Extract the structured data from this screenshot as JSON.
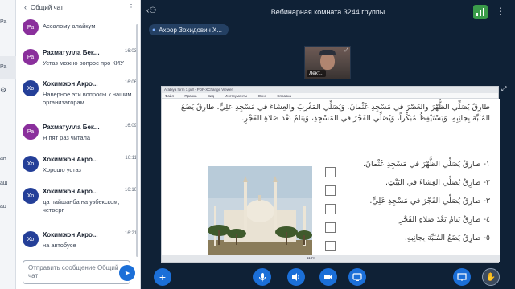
{
  "left_strip": {
    "items": [
      {
        "label": "Ра"
      },
      {
        "label": "ан"
      },
      {
        "label": "аш"
      },
      {
        "label": "ац"
      }
    ]
  },
  "chat": {
    "title": "Общий чат",
    "input_placeholder": "Отправить сообщение Общий чат",
    "messages": [
      {
        "initials": "Ра",
        "name": "",
        "time": "",
        "text": "Ассалому алайкум",
        "avatar_color": "#8a2f9c"
      },
      {
        "initials": "Ра",
        "name": "Рахматулла Бек...",
        "time": "16:03",
        "text": "Устаз можно вопрос про КИУ",
        "avatar_color": "#8a2f9c"
      },
      {
        "initials": "Хо",
        "name": "Хокимжон Акро...",
        "time": "16:06",
        "text": "Наверное эти вопросы к нашим организаторам",
        "avatar_color": "#243f98"
      },
      {
        "initials": "Ра",
        "name": "Рахматулла Бек...",
        "time": "16:09",
        "text": "Я пят раз читала",
        "avatar_color": "#8a2f9c"
      },
      {
        "initials": "Хо",
        "name": "Хокимжон Акро...",
        "time": "16:11",
        "text": "Хорошо устаз",
        "avatar_color": "#243f98"
      },
      {
        "initials": "Хо",
        "name": "Хокимжон Акро...",
        "time": "16:16",
        "text": "да пайшанба на узбекском, четверг",
        "avatar_color": "#243f98"
      },
      {
        "initials": "Хо",
        "name": "Хокимжон Акро...",
        "time": "16:21",
        "text": "на автобусе",
        "avatar_color": "#243f98"
      }
    ]
  },
  "room": {
    "title": "Вебинарная комната 3244 группы",
    "presenter_name": "Ахрор Зохидович Х...",
    "webcam_label": "Лект..."
  },
  "shared_screen": {
    "window_title": "Arabiya form 1.pdf - PDF-XChange Viewer",
    "menu": [
      "Файл",
      "Правка",
      "Вид",
      "Инструменты",
      "Окно",
      "Справка"
    ],
    "paragraph": "طارِقٌ يُصَلِّي الظُّهْرَ والعَصْرَ في مَسْجِدِ عُثْمانَ. وَيُصَلِّي المَغْرِبَ والعِشاءَ في مَسْجِدِ عَلِيٍّ. طارِقٌ يَضَعُ المُنَبِّهَ بِجانِبِهِ، وَيَسْتَيْقِظُ مُبَكِّراً، وَيُصَلِّي الفَجْرَ في المَسْجِدِ، وَيَنامُ بَعْدَ صَلاةِ الفَجْرِ.",
    "exercises": [
      "١- طارِقٌ يُصَلِّي الظُّهْرَ في مَسْجِدِ عُثْمانَ.",
      "٢- طارِقٌ يُصَلِّي العِشاءَ في البَيْتِ.",
      "٣- طارِقٌ يُصَلِّي الفَجْرَ في مَسْجِدِ عَلِيٍّ.",
      "٤- طارِقٌ يَنامُ بَعْدَ صَلاةِ الفَجْرِ.",
      "٥- طارِقٌ يَضَعُ المُنَبِّهَ بِجانِبِهِ."
    ],
    "status_zoom": "118%"
  },
  "toolbar": {
    "icons": [
      "plus-icon",
      "microphone-icon",
      "speaker-icon",
      "camera-icon",
      "screen-share-icon",
      "presentation-icon",
      "raise-hand-icon"
    ]
  },
  "colors": {
    "main_bg": "#0f2136",
    "accent_blue": "#1b6fd8",
    "signal_green": "#3a9b4a",
    "avatar_purple": "#8a2f9c",
    "avatar_blue": "#243f98"
  }
}
